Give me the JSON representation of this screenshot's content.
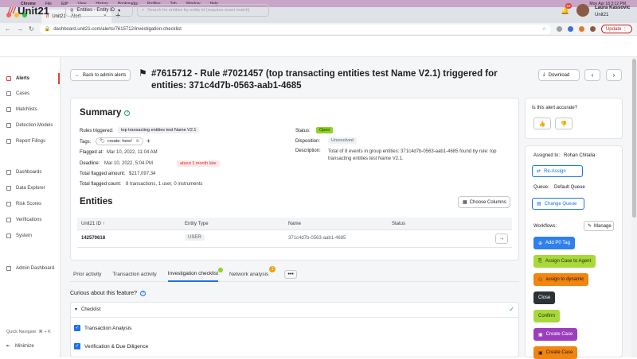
{
  "macbar": {
    "apple": "",
    "items": [
      "Chrome",
      "File",
      "Edit",
      "View",
      "History",
      "Bookmarks",
      "Profiles",
      "Tab",
      "Window",
      "Help"
    ],
    "datetime": "Mon Apr 18  3:12 PM"
  },
  "browser": {
    "tab_title": "Unit21 – Alert",
    "url": "dashboard.unit21.com/alerts/7615712/investigation-checklist",
    "update_label": "Update"
  },
  "header": {
    "logo": "Unit21",
    "entity_select": "Entities - Entity ID",
    "search_placeholder": "Search for entities by entity id (requires exact match)",
    "notif_count": "22",
    "user_name": "Laura Kassovic",
    "user_org": "Unit21"
  },
  "sidebar": {
    "items": [
      "Alerts",
      "Cases",
      "Matchlists",
      "Detection Models",
      "Report Filings",
      "Dashboards",
      "Data Explorer",
      "Risk Scores",
      "Verifications",
      "System",
      "Admin Dashboard"
    ],
    "quick_nav": "Quick Navigate: ⌘ + K",
    "minimize": "Minimize"
  },
  "alert": {
    "back_label": "Back to admin alerts",
    "title": "#7615712 - Rule #7021457 (top transacting entities test Name V2.1) triggered for entities: 371c4d7b-0563-aab1-4685",
    "download_label": "Download"
  },
  "summary": {
    "title": "Summary",
    "rules_label": "Rules triggered:",
    "rules_value": "top transacting entities test Name V2.1",
    "tags_label": "Tags:",
    "tags_value": "create: here!",
    "flagged_label": "Flagged at:",
    "flagged_value": "Mar 10, 2022, 11:04 AM",
    "deadline_label": "Deadline:",
    "deadline_value": "Mar 10, 2022, 5:04 PM",
    "deadline_badge": "about 1 month late",
    "amount_label": "Total flagged amount:",
    "amount_value": "$217,097.34",
    "count_label": "Total flagged count:",
    "count_value": "8 transactions, 1 user, 0 instruments",
    "status_label": "Status:",
    "status_value": "Open",
    "disposition_label": "Disposition:",
    "disposition_value": "Unresolved",
    "description_label": "Description:",
    "description_value": "Total of 8 events in group entities: 371c4d7b-0563-aab1-4685 found by rule: top transacting entities test Name V2.1."
  },
  "entities": {
    "title": "Entities",
    "choose_columns": "Choose Columns",
    "columns": [
      "Unit21 ID ↑",
      "Entity Type",
      "Name",
      "Status"
    ],
    "rows": [
      {
        "id": "142570618",
        "type": "USER",
        "name": "371c4d7b-0563-aab1-4685",
        "status": ""
      }
    ]
  },
  "tabs": {
    "items": [
      "Prior activity",
      "Transaction activity",
      "Investigation checklist",
      "Network analysis"
    ],
    "network_badge": "1",
    "more": "•••"
  },
  "checklist": {
    "curious": "Curious about this feature?",
    "header": "Checklist",
    "items": [
      "Transaction Analysis",
      "Verification & Due Diligence"
    ]
  },
  "right": {
    "accurate_q": "Is this alert accurate?",
    "assigned_label": "Assigned to:",
    "assigned_value": "Rohan Chitalia",
    "reassign": "Re-Assign",
    "queue_label": "Queue:",
    "queue_value": "Default Queue",
    "change_queue": "Change Queue",
    "workflows_label": "Workflows:",
    "manage": "Manage",
    "workflows": [
      {
        "label": "Add P0 Tag",
        "bg": "#2f80ed",
        "fg": "#ffffff"
      },
      {
        "label": "Assign Case to Agent",
        "bg": "#a8d93a",
        "fg": "#1d2b00"
      },
      {
        "label": "assign to dynamic",
        "bg": "#f0850f",
        "fg": "#2b1500"
      },
      {
        "label": "Close",
        "bg": "#2d3138",
        "fg": "#ffffff"
      },
      {
        "label": "Confirm",
        "bg": "#a8d93a",
        "fg": "#1d2b00"
      },
      {
        "label": "Create Case",
        "bg": "#9b3fbd",
        "fg": "#ffffff"
      },
      {
        "label": "Create Case",
        "bg": "#f0850f",
        "fg": "#2b1500"
      }
    ]
  },
  "colors": {
    "brand": "#e0443a",
    "status_open": "#8bd424",
    "link": "#1a73e8"
  }
}
